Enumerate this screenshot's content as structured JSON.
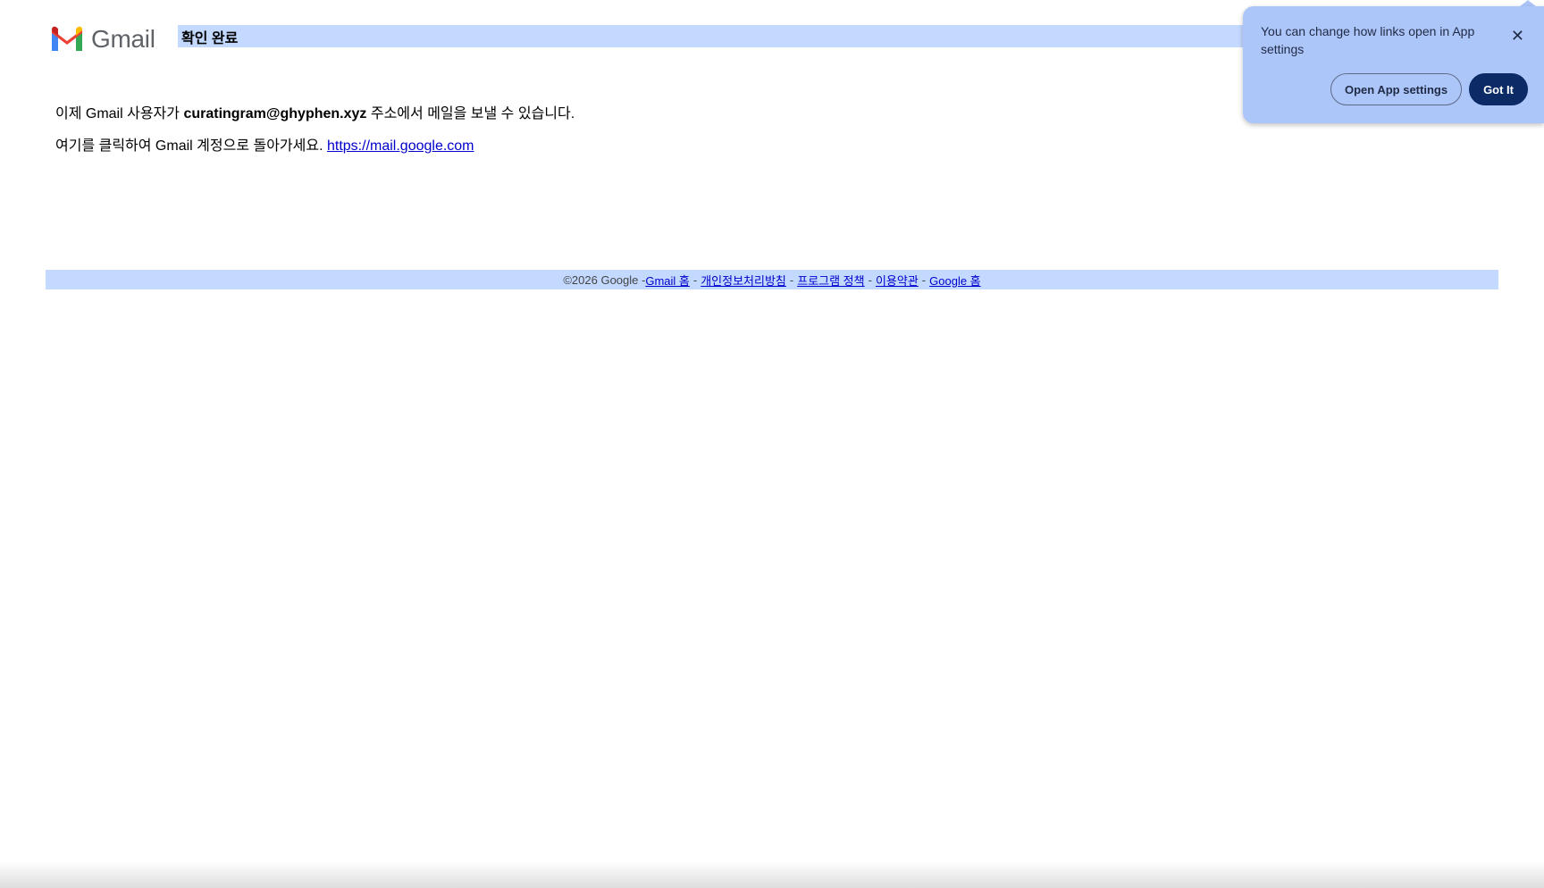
{
  "header": {
    "logo_text": "Gmail",
    "title": "확인 완료"
  },
  "content": {
    "line1_prefix": "이제 Gmail 사용자가 ",
    "line1_email": "curatingram@ghyphen.xyz",
    "line1_suffix": " 주소에서 메일을 보낼 수 있습니다.",
    "line2_prefix": "여기를 클릭하여 Gmail 계정으로 돌아가세요. ",
    "line2_link": "https://mail.google.com"
  },
  "footer": {
    "copyright": "©2026 Google - ",
    "links": [
      "Gmail 홈",
      "개인정보처리방침",
      "프로그램 정책",
      "이용약관",
      "Google 홈"
    ],
    "separator": "-"
  },
  "popup": {
    "message": "You can change how links open in App settings",
    "close_glyph": "✕",
    "secondary_label": "Open App settings",
    "primary_label": "Got It"
  },
  "colors": {
    "title_bar": "#c3d9ff",
    "popup_bg": "#adc6fa",
    "primary_button": "#0b2a66",
    "link": "#0000cc"
  }
}
